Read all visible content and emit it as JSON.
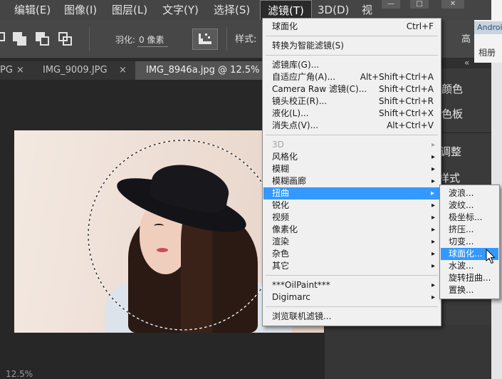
{
  "menubar": {
    "items": [
      "编辑(E)",
      "图像(I)",
      "图层(L)",
      "文字(Y)",
      "选择(S)",
      "滤镜(T)",
      "3D(D)",
      "视"
    ],
    "active_index": 5
  },
  "window_controls": {
    "minimize": "—",
    "maximize": "□",
    "close": "✕"
  },
  "options_bar": {
    "icons": [
      "new-selection-icon",
      "add-to-selection-icon",
      "subtract-from-selection-icon",
      "intersect-selection-icon",
      "anti-alias-icon"
    ],
    "feather_label": "羽化:",
    "feather_value": "0 像素",
    "style_label": "样式:",
    "right_label": "高"
  },
  "tabs": [
    {
      "label": "PG",
      "close": "×"
    },
    {
      "label": "IMG_9009.JPG",
      "close": "×"
    },
    {
      "label": "IMG_8946a.jpg @ 12.5%",
      "active": true
    }
  ],
  "panels": {
    "collapse_icon": "«",
    "labels": [
      "颜色",
      "色板",
      "调整",
      "样式"
    ]
  },
  "other_window": {
    "title": "Androi",
    "item": "相册"
  },
  "status": {
    "zoom": "12.5%"
  },
  "filter_menu": {
    "submenu_arrow": "▸",
    "groups": [
      [
        {
          "label": "球面化",
          "shortcut": "Ctrl+F"
        }
      ],
      [
        {
          "label": "转换为智能滤镜(S)"
        }
      ],
      [
        {
          "label": "滤镜库(G)..."
        },
        {
          "label": "自适应广角(A)...",
          "shortcut": "Alt+Shift+Ctrl+A"
        },
        {
          "label": "Camera Raw 滤镜(C)...",
          "shortcut": "Shift+Ctrl+A"
        },
        {
          "label": "镜头校正(R)...",
          "shortcut": "Shift+Ctrl+R"
        },
        {
          "label": "液化(L)...",
          "shortcut": "Shift+Ctrl+X"
        },
        {
          "label": "消失点(V)...",
          "shortcut": "Alt+Ctrl+V"
        }
      ],
      [
        {
          "label": "3D",
          "submenu": true,
          "disabled": true
        },
        {
          "label": "风格化",
          "submenu": true
        },
        {
          "label": "模糊",
          "submenu": true
        },
        {
          "label": "模糊画廊",
          "submenu": true
        },
        {
          "label": "扭曲",
          "submenu": true,
          "highlighted": true
        },
        {
          "label": "锐化",
          "submenu": true
        },
        {
          "label": "视频",
          "submenu": true
        },
        {
          "label": "像素化",
          "submenu": true
        },
        {
          "label": "渲染",
          "submenu": true
        },
        {
          "label": "杂色",
          "submenu": true
        },
        {
          "label": "其它",
          "submenu": true
        }
      ],
      [
        {
          "label": "***OilPaint***",
          "submenu": true
        },
        {
          "label": "Digimarc",
          "submenu": true
        }
      ],
      [
        {
          "label": "浏览联机滤镜..."
        }
      ]
    ]
  },
  "distort_submenu": {
    "items": [
      {
        "label": "波浪..."
      },
      {
        "label": "波纹..."
      },
      {
        "label": "极坐标..."
      },
      {
        "label": "挤压..."
      },
      {
        "label": "切变..."
      },
      {
        "label": "球面化...",
        "highlighted": true
      },
      {
        "label": "水波..."
      },
      {
        "label": "旋转扭曲..."
      },
      {
        "label": "置换..."
      }
    ]
  },
  "colors": {
    "menu_highlight": "#3399ff",
    "menu_background": "#f0f0f0",
    "ui_dark": "#3a3a3a",
    "menubar": "#454545"
  }
}
